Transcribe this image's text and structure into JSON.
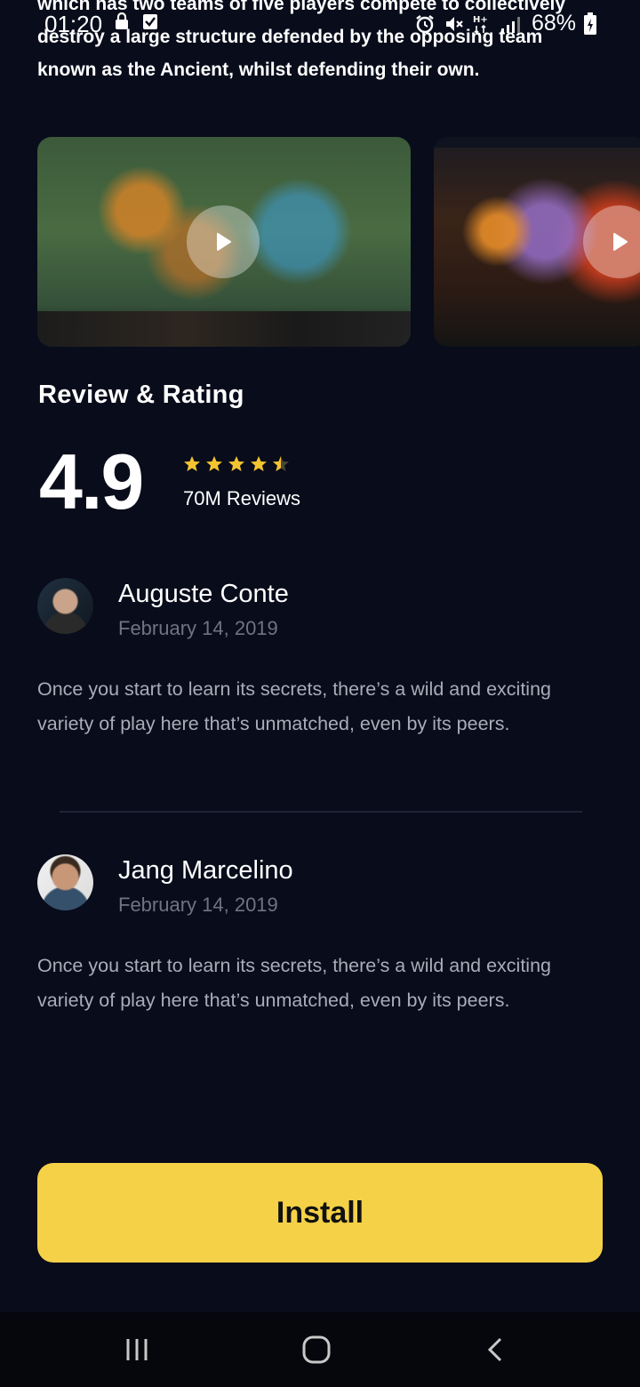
{
  "status_bar": {
    "time": "01:20",
    "battery_percent": "68%",
    "icons": [
      "lock-icon",
      "check-icon",
      "alarm-icon",
      "mute-icon",
      "network-h-plus-icon",
      "signal-icon",
      "battery-charging-icon"
    ]
  },
  "description": {
    "text": "which has two teams of five players compete to collectively destroy a large structure defended by the opposing team known as the Ancient, whilst defending their own."
  },
  "media": {
    "items": [
      {
        "type": "video",
        "icon": "play-icon"
      },
      {
        "type": "video",
        "icon": "play-icon"
      }
    ]
  },
  "rating": {
    "section_title": "Review & Rating",
    "score": "4.9",
    "stars": 4.5,
    "review_count": "70M Reviews",
    "star_color": "#f4c430"
  },
  "reviews": [
    {
      "name": "Auguste Conte",
      "date": "February 14, 2019",
      "text": "Once you start to learn its secrets, there’s a wild and exciting variety of play here that’s unmatched, even by its peers."
    },
    {
      "name": "Jang Marcelino",
      "date": "February 14, 2019",
      "text": "Once you start to learn its secrets, there’s a wild and exciting variety of play here that’s unmatched, even by its peers."
    }
  ],
  "install_button": {
    "label": "Install",
    "color": "#f4d147"
  },
  "nav_bar": {
    "buttons": [
      "recent-apps-icon",
      "home-icon",
      "back-icon"
    ]
  }
}
